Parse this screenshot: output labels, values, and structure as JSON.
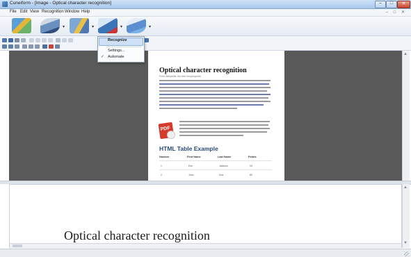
{
  "window": {
    "title": "Cuneiform - [Image - Optical character recognition]",
    "controls": {
      "minimize": "–",
      "maximize": "□",
      "close": "✕"
    }
  },
  "menu": {
    "items": [
      "File",
      "Edit",
      "View",
      "Recognition",
      "Window",
      "Help"
    ],
    "mdi_controls": "– □ ✕"
  },
  "toolbar_big": {
    "tools": [
      {
        "name": "scan-icon"
      },
      {
        "name": "open-image-icon"
      },
      {
        "name": "layout-icon"
      },
      {
        "name": "recognize-icon"
      },
      {
        "name": "export-icon"
      }
    ]
  },
  "recognize_menu": {
    "items": [
      {
        "label": "Recognize",
        "highlighted": true
      },
      {
        "label": "Settings..."
      },
      {
        "label": "Automate",
        "checked": true
      }
    ]
  },
  "document": {
    "title": "Optical character recognition",
    "subtitle": "From Wikipedia, the free encyclopedia",
    "table_heading": "HTML Table Example",
    "table_headers": [
      "Number",
      "First Name",
      "Last Name",
      "Points"
    ],
    "table_rows": [
      [
        "1",
        "Eve",
        "Jackson",
        "94"
      ],
      [
        "2",
        "John",
        "Doe",
        "80"
      ]
    ]
  },
  "recognized_text": "Optical character recognition",
  "colors": {
    "image_background": "#595959",
    "pdf_red": "#d63a2a",
    "heading_blue": "#2a4a7a"
  }
}
